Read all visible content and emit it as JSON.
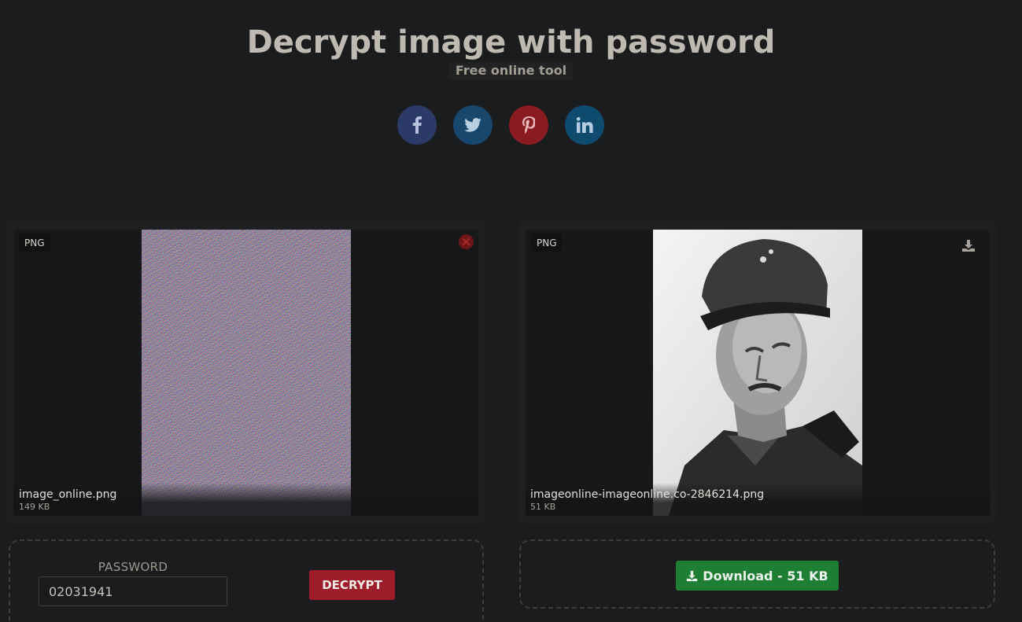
{
  "header": {
    "title": "Decrypt image with password",
    "subtitle": "Free online tool"
  },
  "social": [
    {
      "name": "facebook",
      "icon": "facebook-icon",
      "color": "#2c3a67"
    },
    {
      "name": "twitter",
      "icon": "twitter-icon",
      "color": "#18476e"
    },
    {
      "name": "pinterest",
      "icon": "pinterest-icon",
      "color": "#8a1b20"
    },
    {
      "name": "linkedin",
      "icon": "linkedin-icon",
      "color": "#0f4a6f"
    }
  ],
  "input_image": {
    "format": "PNG",
    "filename": "image_online.png",
    "size": "149 KB",
    "remove_icon": "close-circle-icon"
  },
  "output_image": {
    "format": "PNG",
    "filename": "imageonline-imageonline.co-2846214.png",
    "size": "51 KB",
    "download_icon": "download-icon"
  },
  "password": {
    "label": "PASSWORD",
    "value": "02031941"
  },
  "actions": {
    "decrypt_label": "DECRYPT",
    "download_label": "Download - 51 KB"
  },
  "colors": {
    "background": "#1b1c1e",
    "decrypt": "#9e1d2a",
    "download": "#1e7e34"
  }
}
